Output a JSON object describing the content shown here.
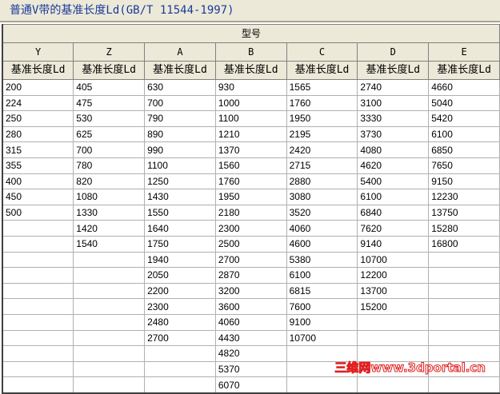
{
  "title": "普通V带的基准长度Ld(GB/T 11544-1997)",
  "table": {
    "group_header": "型号",
    "columns": [
      {
        "type": "Y",
        "subheader": "基准长度Ld",
        "values": [
          "200",
          "224",
          "250",
          "280",
          "315",
          "355",
          "400",
          "450",
          "500"
        ]
      },
      {
        "type": "Z",
        "subheader": "基准长度Ld",
        "values": [
          "405",
          "475",
          "530",
          "625",
          "700",
          "780",
          "820",
          "1080",
          "1330",
          "1420",
          "1540"
        ]
      },
      {
        "type": "A",
        "subheader": "基准长度Ld",
        "values": [
          "630",
          "700",
          "790",
          "890",
          "990",
          "1100",
          "1250",
          "1430",
          "1550",
          "1640",
          "1750",
          "1940",
          "2050",
          "2200",
          "2300",
          "2480",
          "2700"
        ]
      },
      {
        "type": "B",
        "subheader": "基准长度Ld",
        "values": [
          "930",
          "1000",
          "1100",
          "1210",
          "1370",
          "1560",
          "1760",
          "1950",
          "2180",
          "2300",
          "2500",
          "2700",
          "2870",
          "3200",
          "3600",
          "4060",
          "4430",
          "4820",
          "5370",
          "6070"
        ]
      },
      {
        "type": "C",
        "subheader": "基准长度Ld",
        "values": [
          "1565",
          "1760",
          "1950",
          "2195",
          "2420",
          "2715",
          "2880",
          "3080",
          "3520",
          "4060",
          "4600",
          "5380",
          "6100",
          "6815",
          "7600",
          "9100",
          "10700"
        ]
      },
      {
        "type": "D",
        "subheader": "基准长度Ld",
        "values": [
          "2740",
          "3100",
          "3330",
          "3730",
          "4080",
          "4620",
          "5400",
          "6100",
          "6840",
          "7620",
          "9140",
          "10700",
          "12200",
          "13700",
          "15200"
        ]
      },
      {
        "type": "E",
        "subheader": "基准长度Ld",
        "values": [
          "4660",
          "5040",
          "5420",
          "6100",
          "6850",
          "7650",
          "9150",
          "12230",
          "13750",
          "15280",
          "16800"
        ]
      }
    ]
  },
  "watermark": "三维网www.3dportal.cn",
  "colors": {
    "title_text": "#1a3a9a",
    "header_bg": "#ece9d8",
    "watermark": "#e02020"
  }
}
